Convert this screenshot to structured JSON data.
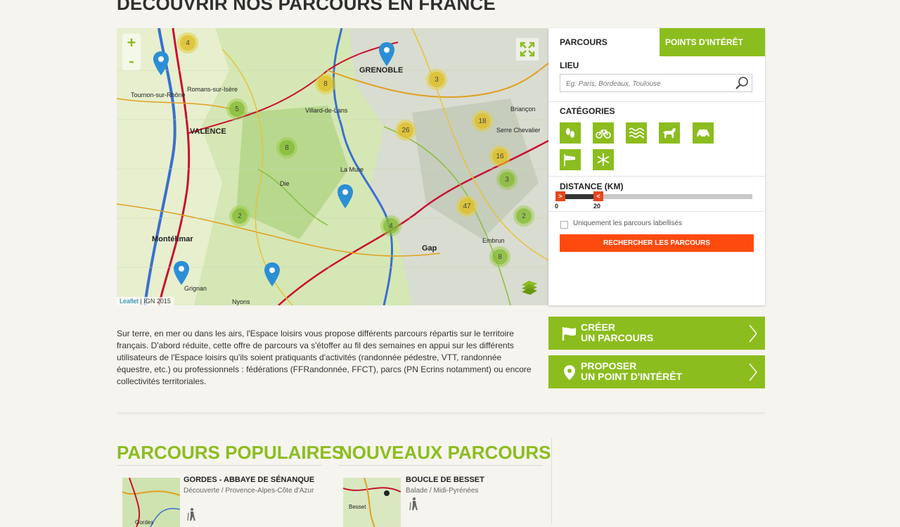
{
  "page_title": "DÉCOUVRIR NOS PARCOURS EN FRANCE",
  "map": {
    "zoom_in": "+",
    "zoom_out": "-",
    "attribution_link": "Leaflet",
    "attribution_rest": " | IGN 2015",
    "towns": [
      {
        "name": "GRENOBLE",
        "big": true
      },
      {
        "name": "VALENCE",
        "big": true
      },
      {
        "name": "Romans-sur-Isère",
        "big": false
      },
      {
        "name": "Montélimar",
        "big": true
      },
      {
        "name": "Gap",
        "big": true
      },
      {
        "name": "Embrun",
        "big": false
      },
      {
        "name": "Die",
        "big": false
      },
      {
        "name": "Grignan",
        "big": false
      },
      {
        "name": "Nyons",
        "big": false
      },
      {
        "name": "Serre Chevalier",
        "big": false
      },
      {
        "name": "Villard-de-Lans",
        "big": false
      },
      {
        "name": "Tournon-sur-Rhône",
        "big": false
      },
      {
        "name": "Briançon",
        "big": false
      },
      {
        "name": "La Mure",
        "big": false
      }
    ],
    "clusters": [
      "4",
      "8",
      "3",
      "26",
      "18",
      "16",
      "47",
      "2",
      "2",
      "4",
      "8",
      "8",
      "5",
      "3"
    ]
  },
  "panel": {
    "tab_routes": "PARCOURS",
    "tab_poi": "POINTS D'INTÉRÊT",
    "location_label": "LIEU",
    "location_placeholder": "Eg: Paris, Bordeaux, Toulouse",
    "categories_label": "CATÉGORIES",
    "categories": [
      "walking-icon",
      "bike-icon",
      "water-icon",
      "horse-icon",
      "car-icon",
      "windsock-icon",
      "snowflake-icon"
    ],
    "distance_label": "DISTANCE (KM)",
    "distance_min": "0",
    "distance_max": "20",
    "handle_left": ">",
    "handle_right": "<",
    "checkbox_label": "Uniquement les parcours labellisés",
    "search_button": "RECHERCHER LES PARCOURS"
  },
  "intro_text": "Sur terre, en mer ou dans les airs, l'Espace loisirs vous propose différents parcours répartis sur le territoire français. D'abord réduite, cette offre de parcours va s'étoffer au fil des semaines en appui sur les différents utilisateurs de l'Espace loisirs qu'ils soient pratiquants d'activités (randonnée pédestre, VTT, randonnée équestre, etc.) ou professionnels : fédérations (FFRandonnée, FFCT), parcs (PN Ecrins notamment) ou encore collectivités territoriales.",
  "cta": {
    "create_line1": "CRÉER",
    "create_line2": "UN PARCOURS",
    "propose_line1": "PROPOSER",
    "propose_line2": "UN POINT D'INTÉRÊT"
  },
  "popular": {
    "title": "PARCOURS POPULAIRES",
    "card": {
      "title": "GORDES - ABBAYE DE SÉNANQUE",
      "meta": "Découverte / Provence-Alpes-Côte d'Azur",
      "thumb_label": "Gordes"
    }
  },
  "newest": {
    "title": "NOUVEAUX PARCOURS",
    "card": {
      "title": "BOUCLE DE BESSET",
      "meta": "Balade / Midi-Pyrénées",
      "thumb_label": "Besset"
    }
  },
  "colors": {
    "accent": "#8cbd1e",
    "cta_orange": "#ff4a0f",
    "marker": "#2b8fd6"
  }
}
